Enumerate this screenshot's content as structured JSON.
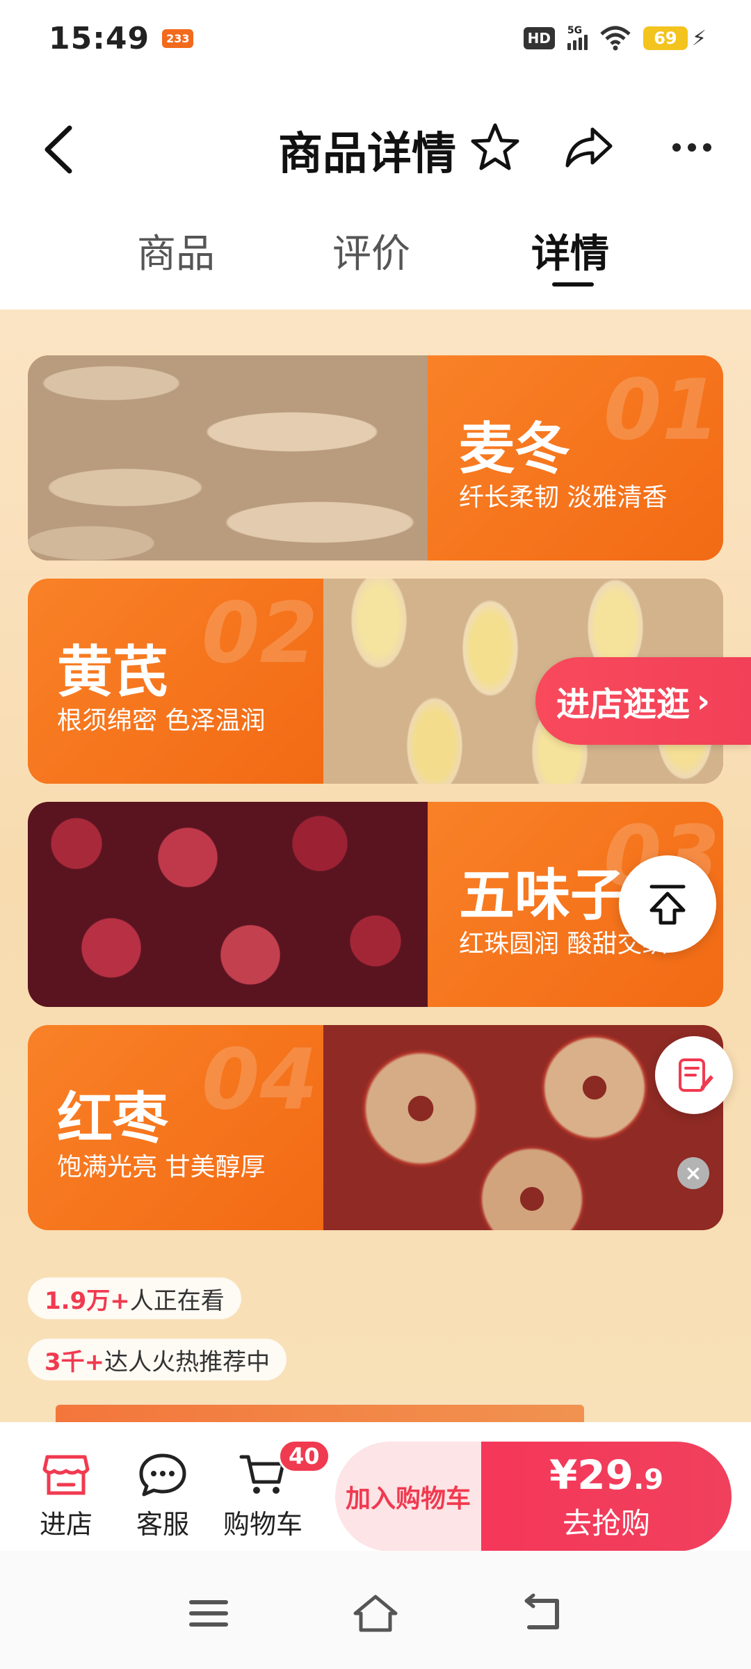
{
  "status_bar": {
    "time": "15:49",
    "notification_badge": "233",
    "hd_label": "HD",
    "network_label": "5G",
    "battery_level": "69"
  },
  "nav": {
    "title": "商品详情"
  },
  "tabs": [
    {
      "label": "商品",
      "active": false
    },
    {
      "label": "评价",
      "active": false
    },
    {
      "label": "详情",
      "active": true
    }
  ],
  "products": [
    {
      "number": "01",
      "name": "麦冬",
      "desc": "纤长柔韧  淡雅清香"
    },
    {
      "number": "02",
      "name": "黄芪",
      "desc": "根须绵密  色泽温润"
    },
    {
      "number": "03",
      "name": "五味子",
      "desc": "红珠圆润  酸甜交织"
    },
    {
      "number": "04",
      "name": "红枣",
      "desc": "饱满光亮  甘美醇厚"
    }
  ],
  "float": {
    "enter_shop": "进店逛逛"
  },
  "stats": {
    "viewing_count": "1.9万+",
    "viewing_text": "人正在看",
    "recommend_count": "3千+",
    "recommend_text": "达人火热推荐中"
  },
  "action_bar": {
    "shop_label": "进店",
    "service_label": "客服",
    "cart_label": "购物车",
    "cart_count": "40",
    "add_to_cart": "加入购物车",
    "price_main": "¥29",
    "price_decimal": ".9",
    "buy_label": "去抢购"
  },
  "colors": {
    "accent_orange": "#f6731f",
    "accent_red": "#f03a50"
  }
}
